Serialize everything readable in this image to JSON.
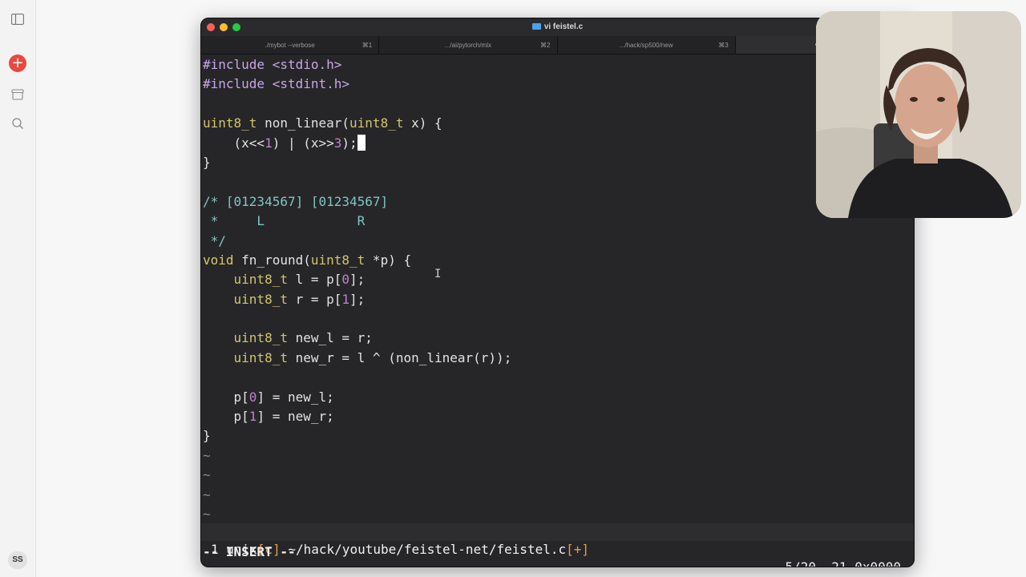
{
  "window": {
    "title": "vi feistel.c"
  },
  "tabs": [
    {
      "label": "./mybot --verbose",
      "key": "⌘1"
    },
    {
      "label": ".../ai/pytorch/mlx",
      "key": "⌘2"
    },
    {
      "label": ".../hack/sp500/new",
      "key": "⌘3"
    },
    {
      "label": "vi feist",
      "key": ""
    }
  ],
  "rail": {
    "badge": "SS"
  },
  "code": {
    "l1_dir": "#include",
    "l1_hdr": " <stdio.h>",
    "l2_dir": "#include",
    "l2_hdr": " <stdint.h>",
    "l4_t1": "uint8_t",
    "l4_mid": " non_linear(",
    "l4_t2": "uint8_t",
    "l4_end": " x) {",
    "l5_a": "    (x<<",
    "l5_n1": "1",
    "l5_b": ") | (x>>",
    "l5_n2": "3",
    "l5_c": ");",
    "l6": "}",
    "l8": "/* [01234567] [01234567]",
    "l9": " *     L            R",
    "l10": " */",
    "l11_kw": "void",
    "l11_mid": " fn_round(",
    "l11_t": "uint8_t",
    "l11_end": " *p) {",
    "l12_t": "    uint8_t",
    "l12_a": " l = p[",
    "l12_n": "0",
    "l12_b": "];",
    "l13_t": "    uint8_t",
    "l13_a": " r = p[",
    "l13_n": "1",
    "l13_b": "];",
    "l15_t": "    uint8_t",
    "l15_a": " new_l = r;",
    "l16_t": "    uint8_t",
    "l16_a": " new_r = l ^ (non_linear(r));",
    "l18_a": "    p[",
    "l18_n": "0",
    "l18_b": "] = new_l;",
    "l19_a": "    p[",
    "l19_n": "1",
    "l19_b": "] = new_r;",
    "l20": "}",
    "tilde": "~"
  },
  "status": {
    "buf": "1",
    "fmt": "unix",
    "ft_open": "[",
    "ft": "c",
    "ft_close": "]",
    "path": "~/hack/youtube/feistel-net/feistel.c",
    "mod": "[+]",
    "pos": "5/20",
    "col": "21",
    "hex": "0x0000"
  },
  "mode": "-- INSERT --",
  "icons": {
    "sidebar_toggle": "sidebar-icon",
    "new": "plus-icon",
    "archive": "archive-icon",
    "search": "search-icon"
  },
  "colors": {
    "accent": "#e8493f",
    "terminal_bg": "#262629",
    "comment": "#7fc6c0",
    "type": "#d2c46a",
    "number": "#c07fd4"
  }
}
